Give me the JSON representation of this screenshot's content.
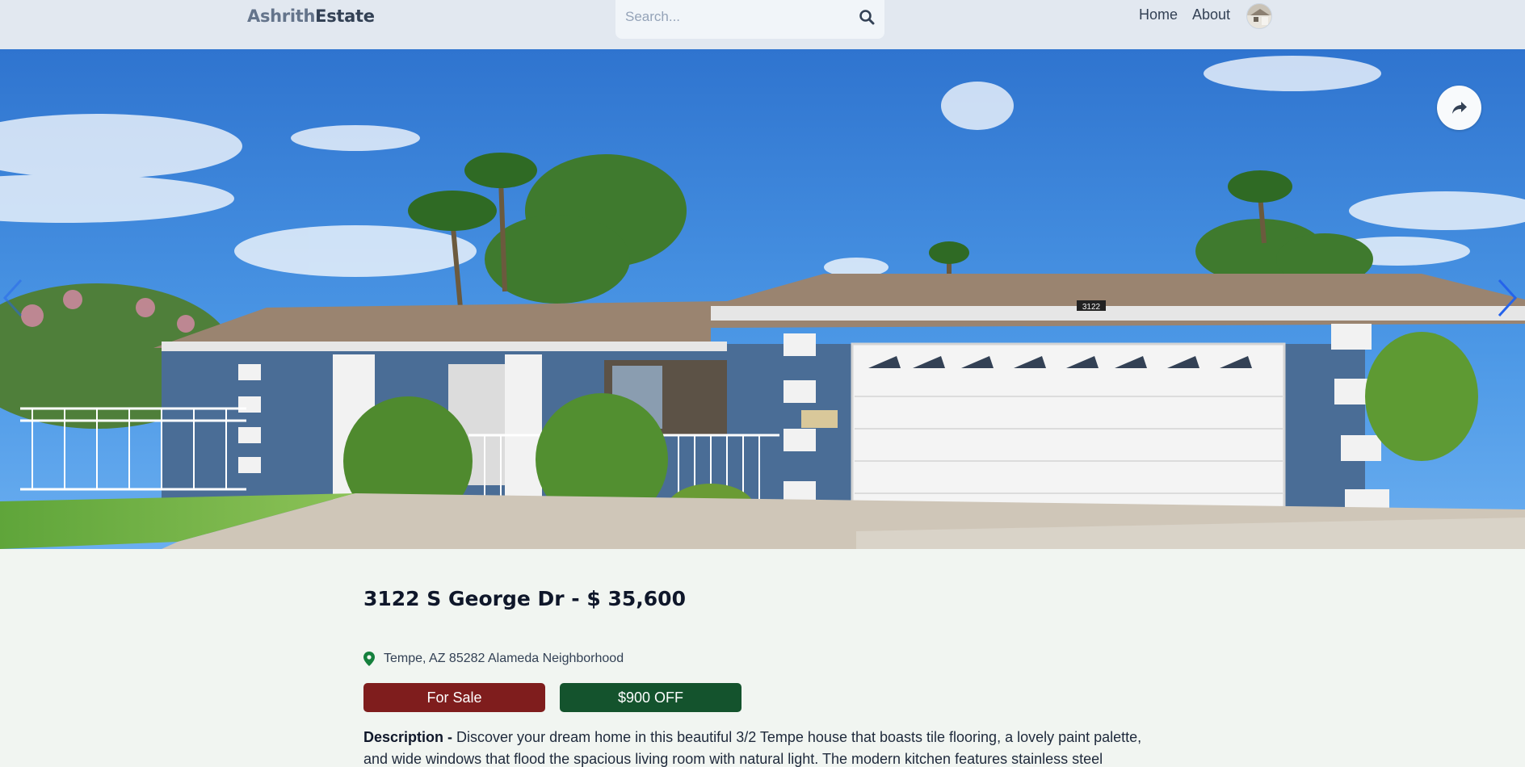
{
  "header": {
    "logo_part1": "Ashrith",
    "logo_part2": "Estate",
    "search_placeholder": "Search...",
    "nav_home": "Home",
    "nav_about": "About"
  },
  "hero": {
    "house_number": "3122"
  },
  "listing": {
    "title": "3122 S George Dr - $ 35,600",
    "address": "Tempe, AZ 85282 Alameda Neighborhood",
    "status_badge": "For Sale",
    "discount_badge": "$900 OFF",
    "description_label": "Description -",
    "description_text": "Discover your dream home in this beautiful 3/2 Tempe house that boasts tile flooring, a lovely paint palette, and wide windows that flood the spacious living room with natural light. The modern kitchen features stainless steel"
  },
  "colors": {
    "header_bg": "#e2e8f0",
    "page_bg": "#f1f5f1",
    "sale_badge": "#7f1d1d",
    "off_badge": "#14532d",
    "pin_green": "#15803d"
  }
}
